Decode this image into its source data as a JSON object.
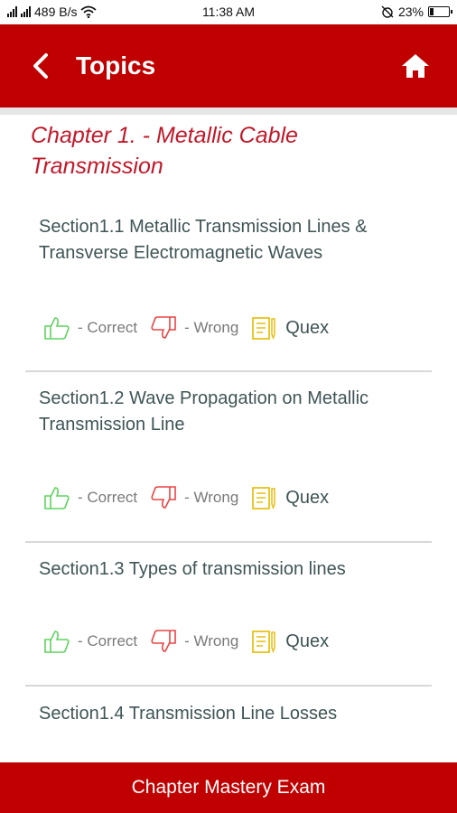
{
  "status_bar": {
    "network_speed": "489 B/s",
    "time": "11:38 AM",
    "battery_percent": "23%",
    "battery_level": 0.23
  },
  "app_bar": {
    "title": "Topics"
  },
  "chapter": {
    "title": "Chapter 1. - Metallic Cable Transmission"
  },
  "sections": [
    {
      "title": "Section1.1 Metallic Transmission Lines & Transverse Electromagnetic Waves"
    },
    {
      "title": "Section1.2 Wave Propagation on Metallic Transmission Line"
    },
    {
      "title": "Section1.3 Types of transmission lines"
    },
    {
      "title": "Section1.4 Transmission Line Losses"
    }
  ],
  "actions": {
    "correct_label": "- Correct",
    "wrong_label": "- Wrong",
    "quex_label": "Quex"
  },
  "bottom_bar": {
    "label": "Chapter Mastery Exam"
  },
  "colors": {
    "primary": "#c00000",
    "chapter_title": "#c0192a",
    "correct": "#5fd35f",
    "wrong": "#e84545",
    "quex": "#e8c21c",
    "section_text": "#3f5456"
  }
}
